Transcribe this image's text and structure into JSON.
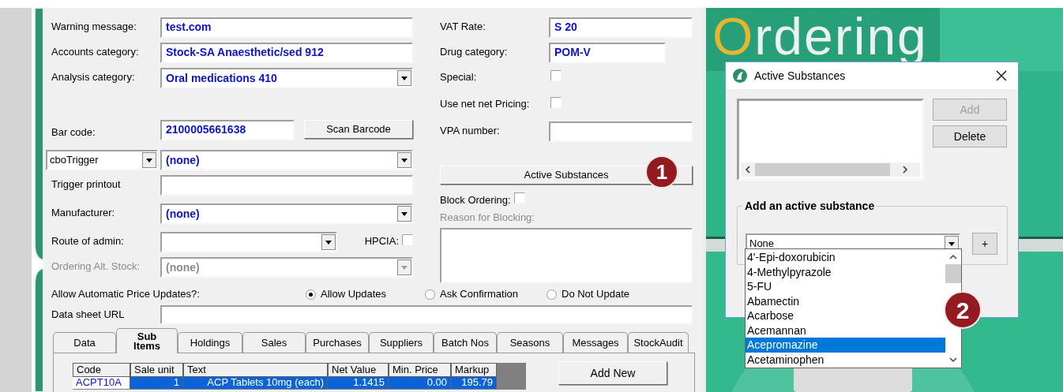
{
  "form": {
    "left_fields": [
      {
        "kind": "text",
        "label": "Warning message:",
        "value": "test.com"
      },
      {
        "kind": "text",
        "label": "Accounts category:",
        "value": "Stock-SA Anaesthetic/sed 912"
      },
      {
        "kind": "combo",
        "label": "Analysis category:",
        "value": "Oral medications 410",
        "disabled": false
      },
      {
        "kind": "barcode",
        "label": "Bar code:",
        "value": "2100005661638",
        "button": "Scan Barcode"
      },
      {
        "kind": "trigger",
        "selector": "cboTrigger",
        "value": "(none)"
      },
      {
        "kind": "text",
        "label": "Trigger printout"
      },
      {
        "kind": "combo",
        "label": "Manufacturer:",
        "value": "(none)",
        "disabled": false
      },
      {
        "kind": "route",
        "label": "Route of admin:",
        "check_label": "HPCIA:",
        "checked": false
      },
      {
        "kind": "combo",
        "label": "Ordering Alt. Stock:",
        "value": "(none)",
        "disabled": true
      }
    ],
    "right_fields": [
      {
        "kind": "text",
        "label": "VAT Rate:",
        "value": "S 20"
      },
      {
        "kind": "short_text",
        "label": "Drug category:",
        "value": "POM-V"
      },
      {
        "kind": "check",
        "label": "Special:",
        "checked": false
      },
      {
        "kind": "check",
        "label": "Use net net Pricing:",
        "checked": false
      },
      {
        "kind": "text",
        "label": "VPA number:"
      },
      {
        "kind": "button",
        "label": "Active Substances"
      },
      {
        "kind": "inline_check",
        "label": "Block Ordering:",
        "checked": false
      },
      {
        "kind": "memo",
        "label": "Reason for Blocking:",
        "disabled": true
      }
    ],
    "price_updates": {
      "label": "Allow Automatic Price Updates?:",
      "options": [
        {
          "label": "Allow Updates",
          "selected": true
        },
        {
          "label": "Ask Confirmation",
          "selected": false
        },
        {
          "label": "Do Not Update",
          "selected": false
        }
      ]
    },
    "data_sheet": {
      "label": "Data sheet URL"
    },
    "tabs": [
      {
        "label": "Data",
        "selected": false
      },
      {
        "label": "Sub Items",
        "selected": true
      },
      {
        "label": "Holdings",
        "selected": false
      },
      {
        "label": "Sales",
        "selected": false
      },
      {
        "label": "Purchases",
        "selected": false
      },
      {
        "label": "Suppliers",
        "selected": false
      },
      {
        "label": "Batch Nos",
        "selected": false
      },
      {
        "label": "Seasons",
        "selected": false
      },
      {
        "label": "Messages",
        "selected": false
      },
      {
        "label": "StockAudit",
        "selected": false
      }
    ],
    "table": {
      "columns": [
        "Code",
        "Sale unit",
        "Text",
        "Net Value",
        "Min. Price",
        "Markup"
      ],
      "rows": [
        {
          "cells": [
            "ACPT10A",
            "1",
            "ACP Tablets 10mg (each)",
            "1.1415",
            "0.00",
            "195.79"
          ],
          "selected": true
        }
      ]
    },
    "add_new_button": "Add New"
  },
  "banner": "Ordering",
  "dialog": {
    "title": "Active Substances",
    "add_button": {
      "label": "Add",
      "disabled": true
    },
    "delete_button": {
      "label": "Delete",
      "disabled": false
    },
    "group_label": "Add an active substance",
    "combo_value": "None",
    "plus_button": "+",
    "options": [
      {
        "label": "4'-Epi-doxorubicin",
        "selected": false
      },
      {
        "label": "4-Methylpyrazole",
        "selected": false
      },
      {
        "label": "5-FU",
        "selected": false
      },
      {
        "label": "Abamectin",
        "selected": false
      },
      {
        "label": "Acarbose",
        "selected": false
      },
      {
        "label": "Acemannan",
        "selected": false
      },
      {
        "label": "Acepromazine",
        "selected": true
      },
      {
        "label": "Acetaminophen",
        "selected": false
      }
    ]
  },
  "callouts": [
    "1",
    "2"
  ]
}
